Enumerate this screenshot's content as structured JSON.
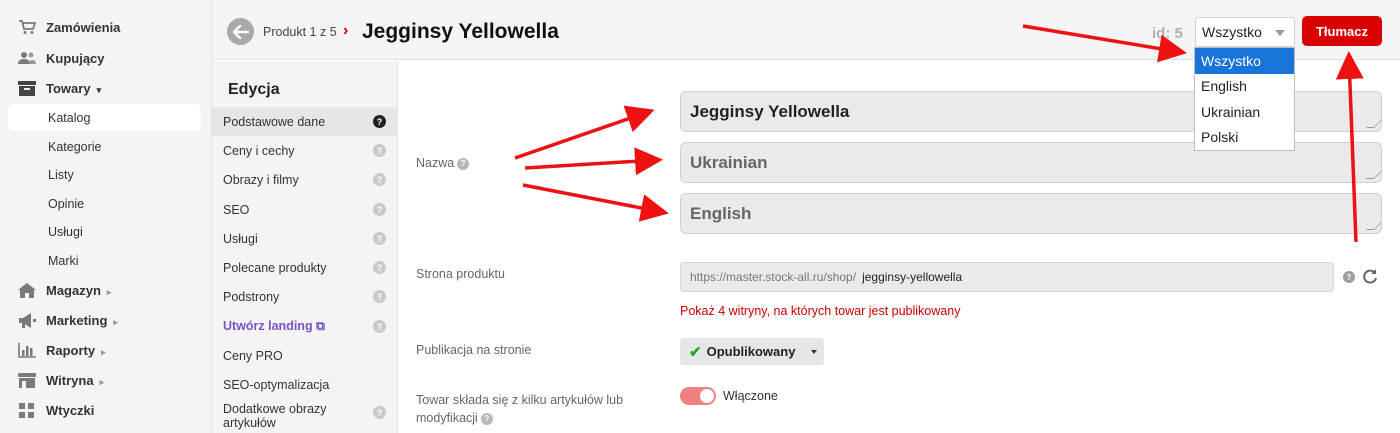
{
  "sidebar": {
    "items": [
      {
        "icon": "cart-icon",
        "label": "Zamówienia"
      },
      {
        "icon": "users-icon",
        "label": "Kupujący"
      },
      {
        "icon": "box-icon",
        "label": "Towary",
        "arrow": "▾"
      },
      {
        "icon": "warehouse-icon",
        "label": "Magazyn",
        "arrow": "▸"
      },
      {
        "icon": "megaphone-icon",
        "label": "Marketing",
        "arrow": "▸"
      },
      {
        "icon": "chart-icon",
        "label": "Raporty",
        "arrow": "▸"
      },
      {
        "icon": "storefront-icon",
        "label": "Witryna",
        "arrow": "▸"
      },
      {
        "icon": "plugins-icon",
        "label": "Wtyczki"
      }
    ],
    "towary_sub": [
      "Katalog",
      "Kategorie",
      "Listy",
      "Opinie",
      "Usługi",
      "Marki"
    ]
  },
  "header": {
    "breadcrumb": "Produkt 1 z 5",
    "title": "Jegginsy Yellowella",
    "id_label": "id: 5",
    "language_select": {
      "value": "Wszystko",
      "options": [
        "Wszystko",
        "English",
        "Ukrainian",
        "Polski"
      ]
    },
    "translate_label": "Tłumacz"
  },
  "edit_menu": {
    "title": "Edycja",
    "items": [
      {
        "label": "Podstawowe dane",
        "help": "?"
      },
      {
        "label": "Ceny i cechy",
        "help": "?"
      },
      {
        "label": "Obrazy i filmy",
        "help": "?"
      },
      {
        "label": "SEO",
        "help": "?"
      },
      {
        "label": "Usługi",
        "help": "?"
      },
      {
        "label": "Polecane produkty",
        "help": "?"
      },
      {
        "label": "Podstrony",
        "help": "?"
      },
      {
        "label": "Utwórz landing ⧉",
        "help": "?"
      },
      {
        "label": "Ceny PRO"
      },
      {
        "label": "SEO-optymalizacja"
      },
      {
        "label": "Dodatkowe obrazy artykułów",
        "help": "?"
      }
    ]
  },
  "form": {
    "name_label": "Nazwa",
    "help_mark": "?",
    "name_values": [
      "Jegginsy Yellowella",
      "Ukrainian",
      "English"
    ],
    "page_label": "Strona produktu",
    "url_prefix": "https://master.stock-all.ru/shop/",
    "url_slug": "jegginsy-yellowella",
    "published_sites_link": "Pokaż 4 witryny, na których towar jest publikowany",
    "publication_label": "Publikacja na stronie",
    "publication_status": "Opublikowany",
    "variants_label": "Towar składa się z kilku artykułów lub modyfikacji",
    "variants_toggle": "Włączone"
  },
  "colors": {
    "accent_red": "#d80000",
    "select_blue": "#1a73d8",
    "link_red": "#cc0000",
    "toggle_pink": "#f08080",
    "purple": "#7a52c8"
  }
}
